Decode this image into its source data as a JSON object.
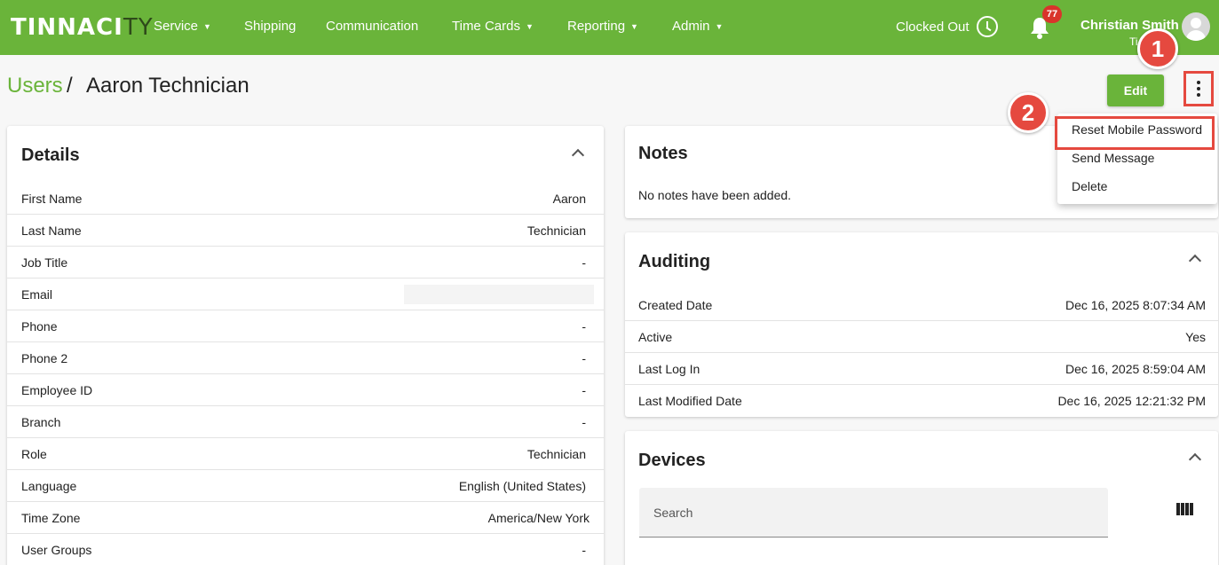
{
  "app": {
    "logo_main": "TINNACI",
    "logo_tail": "TY"
  },
  "nav": {
    "service": "Service",
    "shipping": "Shipping",
    "communication": "Communication",
    "time_cards": "Time Cards",
    "reporting": "Reporting",
    "admin": "Admin",
    "clock_status": "Clocked Out",
    "notification_count": "77",
    "user_name": "Christian Smith",
    "user_sub": "Ti"
  },
  "breadcrumb": {
    "users": "Users",
    "separator": "/",
    "current": "Aaron Technician"
  },
  "toolbar": {
    "edit_label": "Edit"
  },
  "menu": {
    "items": [
      "Reset Mobile Password",
      "Send Message",
      "Delete"
    ]
  },
  "callouts": {
    "step1": "1",
    "step2": "2"
  },
  "details": {
    "title": "Details",
    "rows": [
      {
        "label": "First Name",
        "value": "Aaron"
      },
      {
        "label": "Last Name",
        "value": "Technician"
      },
      {
        "label": "Job Title",
        "value": "-"
      },
      {
        "label": "Email",
        "value": ""
      },
      {
        "label": "Phone",
        "value": "-"
      },
      {
        "label": "Phone 2",
        "value": "-"
      },
      {
        "label": "Employee ID",
        "value": "-"
      },
      {
        "label": "Branch",
        "value": "-"
      },
      {
        "label": "Role",
        "value": "Technician"
      },
      {
        "label": "Language",
        "value": "English (United States)"
      },
      {
        "label": "Time Zone",
        "value": "America/New York"
      },
      {
        "label": "User Groups",
        "value": "-"
      }
    ]
  },
  "notes": {
    "title": "Notes",
    "empty_text": "No notes have been added."
  },
  "auditing": {
    "title": "Auditing",
    "rows": [
      {
        "label": "Created Date",
        "value": "Dec 16, 2025 8:07:34 AM"
      },
      {
        "label": "Active",
        "value": "Yes"
      },
      {
        "label": "Last Log In",
        "value": "Dec 16, 2025 8:59:04 AM"
      },
      {
        "label": "Last Modified Date",
        "value": "Dec 16, 2025 12:21:32 PM"
      }
    ]
  },
  "devices": {
    "title": "Devices",
    "search_placeholder": "Search"
  },
  "colors": {
    "brand": "#6ab43a",
    "highlight": "#e5493f",
    "badge": "#d9342b"
  },
  "icons": [
    "clock-icon",
    "bell-icon",
    "avatar-icon",
    "kebab-icon",
    "chevron-up-icon",
    "columns-icon",
    "caret-down-icon"
  ]
}
